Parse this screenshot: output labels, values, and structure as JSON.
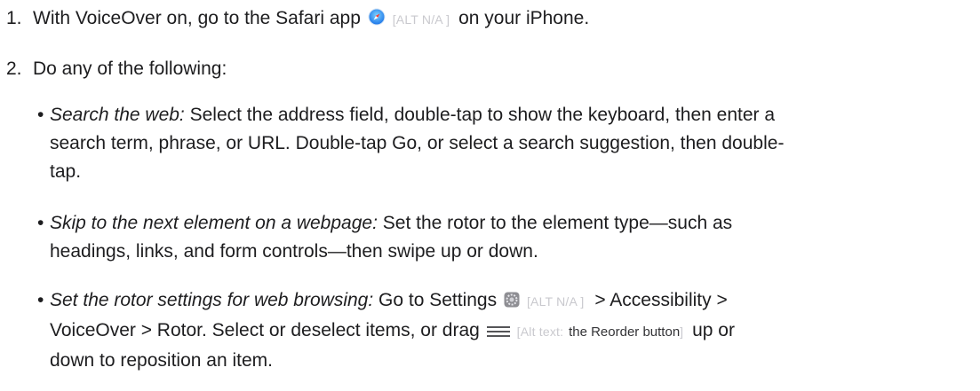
{
  "steps": [
    {
      "number": "1.",
      "before": "With VoiceOver on, go to the Safari app",
      "icon": "safari-icon",
      "alt": "[ALT N/A ]",
      "after": "on your iPhone."
    },
    {
      "number": "2.",
      "text": "Do any of the following:"
    }
  ],
  "bullets": [
    {
      "lead": "Search the web:",
      "line1": "Select the address field, double-tap to show the keyboard, then enter a",
      "line2": "search term, phrase, or URL. Double-tap Go, or select a search suggestion, then double-",
      "line3": "tap."
    },
    {
      "lead": "Skip to the next element on a webpage:",
      "line1": "Set the rotor to the element type—such as",
      "line2": "headings, links, and form controls—then swipe up or down."
    },
    {
      "lead": "Set the rotor settings for web browsing:",
      "line1_before": "Go to Settings",
      "settings_icon": "settings-icon",
      "settings_alt": "[ALT N/A ]",
      "line1_after": "> Accessibility >",
      "line2_before": "VoiceOver > Rotor. Select or deselect items, or drag",
      "reorder_icon": "reorder-icon",
      "reorder_alt_prefix": "[Alt text:",
      "reorder_alt_name": "the Reorder button",
      "reorder_alt_suffix": "]",
      "line2_after": "up or",
      "line3": "down to reposition an item."
    }
  ]
}
